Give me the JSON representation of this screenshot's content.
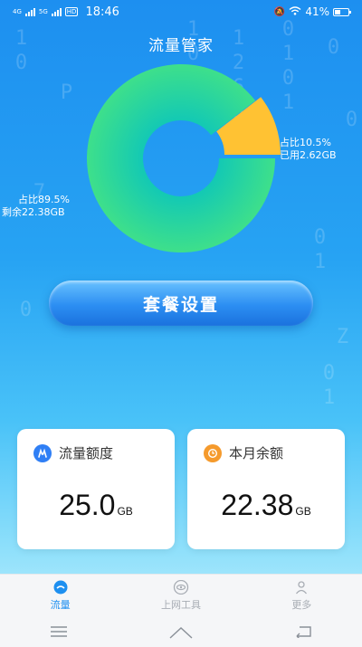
{
  "status_bar": {
    "network_1": "4G",
    "network_2": "5G",
    "hd": "HD",
    "time": "18:46",
    "battery": "41%"
  },
  "header": {
    "title": "流量管家"
  },
  "usage": {
    "used_share": "占比10.5%",
    "used_amount": "已用2.62GB",
    "remaining_share": "占比89.5%",
    "remaining_amount": "剩余22.38GB"
  },
  "chart_data": {
    "type": "pie",
    "style": "donut",
    "categories": [
      "剩余",
      "已用"
    ],
    "values": [
      89.5,
      10.5
    ],
    "colors": [
      "#2ddc8a",
      "#ffc233"
    ]
  },
  "plan_button": {
    "label": "套餐设置"
  },
  "cards": [
    {
      "title": "流量额度",
      "value": "25.0",
      "unit": "GB",
      "icon": "quota-icon",
      "icon_color": "#2f7ff5"
    },
    {
      "title": "本月余额",
      "value": "22.38",
      "unit": "GB",
      "icon": "clock-icon",
      "icon_color": "#f59a2c"
    }
  ],
  "bottom_nav": {
    "items": [
      {
        "label": "流量",
        "icon": "traffic-icon",
        "active": true
      },
      {
        "label": "上网工具",
        "icon": "eye-icon",
        "active": false
      },
      {
        "label": "更多",
        "icon": "person-icon",
        "active": false
      }
    ]
  },
  "system_nav": {
    "icons": [
      "menu-icon",
      "home-icon",
      "back-icon"
    ]
  }
}
